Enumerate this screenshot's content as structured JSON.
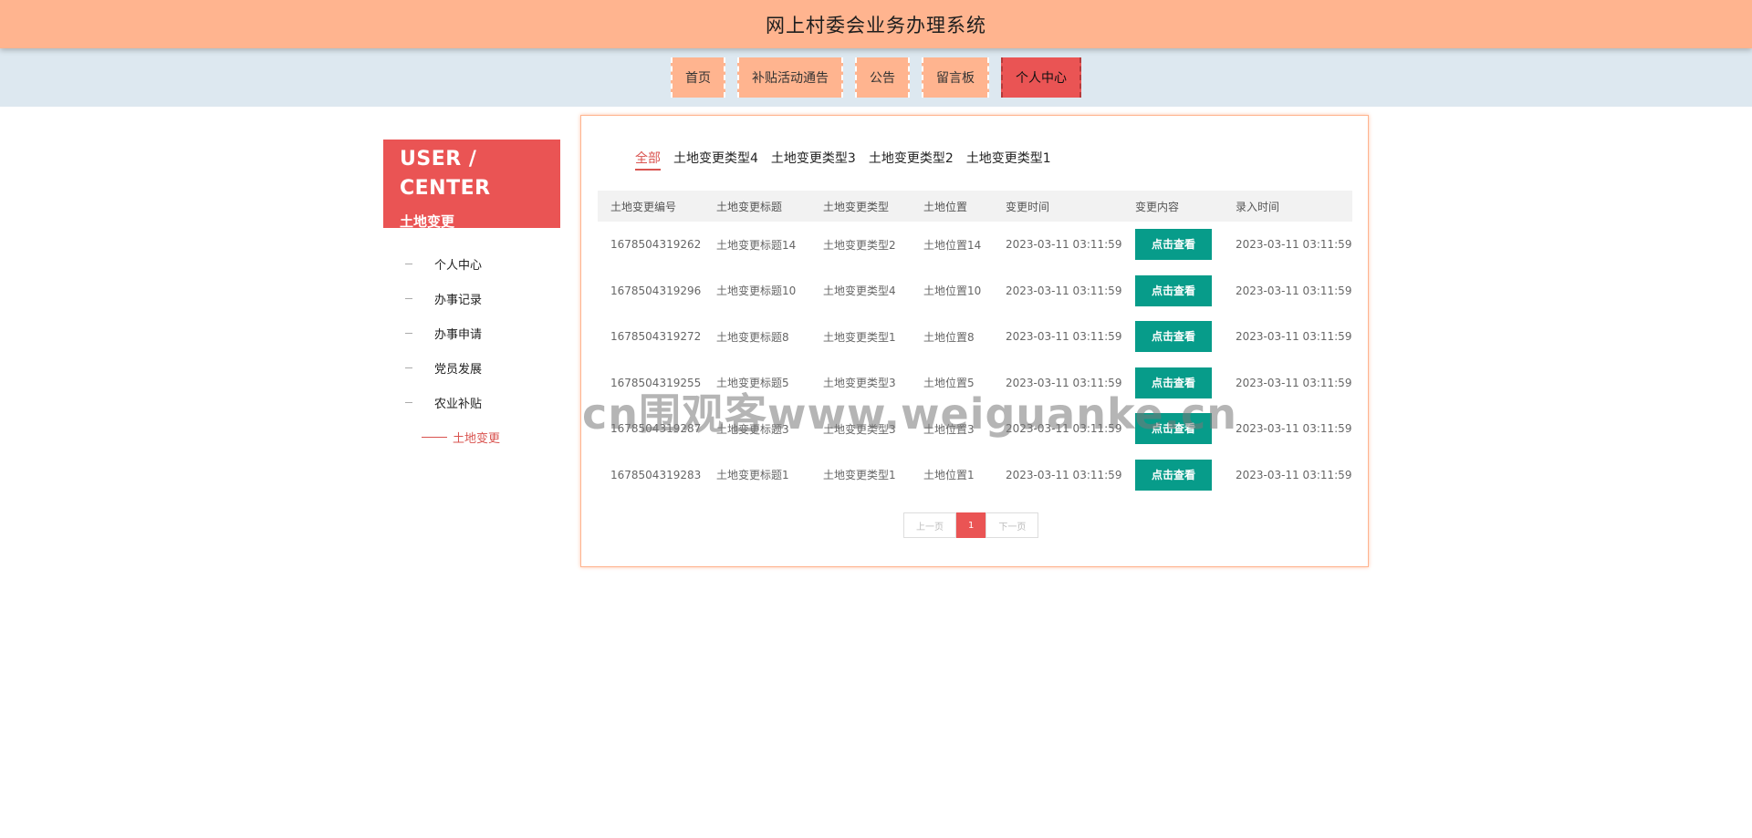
{
  "header": {
    "title": "网上村委会业务办理系统"
  },
  "nav": {
    "items": [
      {
        "label": "首页"
      },
      {
        "label": "补贴活动通告"
      },
      {
        "label": "公告"
      },
      {
        "label": "留言板"
      },
      {
        "label": "个人中心"
      }
    ],
    "active_index": 4
  },
  "sidebar": {
    "title": "USER / CENTER",
    "subtitle": "土地变更",
    "items": [
      {
        "label": "个人中心"
      },
      {
        "label": "办事记录"
      },
      {
        "label": "办事申请"
      },
      {
        "label": "党员发展"
      },
      {
        "label": "农业补贴"
      }
    ],
    "sub_item": {
      "label": "土地变更"
    }
  },
  "filters": {
    "tabs": [
      {
        "label": "全部"
      },
      {
        "label": "土地变更类型4"
      },
      {
        "label": "土地变更类型3"
      },
      {
        "label": "土地变更类型2"
      },
      {
        "label": "土地变更类型1"
      }
    ],
    "active_index": 0
  },
  "table": {
    "headers": [
      "土地变更编号",
      "土地变更标题",
      "土地变更类型",
      "土地位置",
      "变更时间",
      "变更内容",
      "录入时间"
    ],
    "view_label": "点击查看",
    "rows": [
      {
        "id": "1678504319262",
        "title": "土地变更标题14",
        "type": "土地变更类型2",
        "location": "土地位置14",
        "change_time": "2023-03-11 03:11:59",
        "entry_time": "2023-03-11 03:11:59"
      },
      {
        "id": "1678504319296",
        "title": "土地变更标题10",
        "type": "土地变更类型4",
        "location": "土地位置10",
        "change_time": "2023-03-11 03:11:59",
        "entry_time": "2023-03-11 03:11:59"
      },
      {
        "id": "1678504319272",
        "title": "土地变更标题8",
        "type": "土地变更类型1",
        "location": "土地位置8",
        "change_time": "2023-03-11 03:11:59",
        "entry_time": "2023-03-11 03:11:59"
      },
      {
        "id": "1678504319255",
        "title": "土地变更标题5",
        "type": "土地变更类型3",
        "location": "土地位置5",
        "change_time": "2023-03-11 03:11:59",
        "entry_time": "2023-03-11 03:11:59"
      },
      {
        "id": "1678504319287",
        "title": "土地变更标题3",
        "type": "土地变更类型3",
        "location": "土地位置3",
        "change_time": "2023-03-11 03:11:59",
        "entry_time": "2023-03-11 03:11:59"
      },
      {
        "id": "1678504319283",
        "title": "土地变更标题1",
        "type": "土地变更类型1",
        "location": "土地位置1",
        "change_time": "2023-03-11 03:11:59",
        "entry_time": "2023-03-11 03:11:59"
      }
    ]
  },
  "pagination": {
    "prev": "上一页",
    "current": "1",
    "next": "下一页"
  },
  "watermark": {
    "text": "cn围观客www.weiguanke.cn"
  },
  "colors": {
    "header": "#ffb48f",
    "accent": "#ea5454",
    "button": "#079c8a",
    "nav_bg": "#dde8f0"
  }
}
